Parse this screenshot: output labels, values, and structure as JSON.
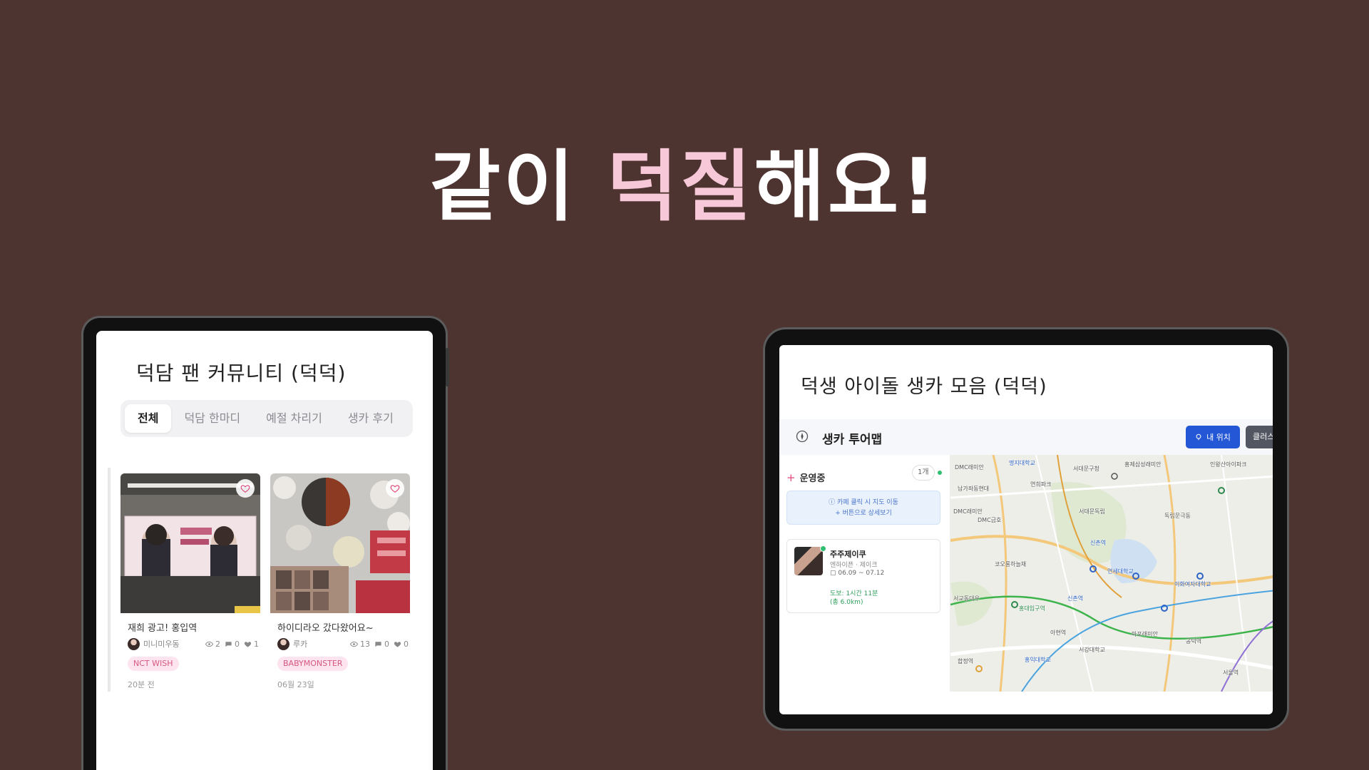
{
  "headline": {
    "part1": "같이",
    "highlight": "덕질",
    "part2": "해요!"
  },
  "colors": {
    "background": "#4e3430",
    "highlight": "#f7c9d8",
    "accent_blue": "#2457d6",
    "tag_pink": "#d9577f"
  },
  "community": {
    "title": "덕담 팬 커뮤니티 (덕덕)",
    "tabs": [
      {
        "label": "전체",
        "active": true
      },
      {
        "label": "덕담 한마디",
        "active": false
      },
      {
        "label": "예절 차리기",
        "active": false
      },
      {
        "label": "생카 후기",
        "active": false
      }
    ],
    "posts": [
      {
        "title": "재희 광고! 홍입역",
        "author": "미니미우동",
        "views": "2",
        "comments": "0",
        "likes": "1",
        "tag": "NCT WISH",
        "time": "20분 전",
        "icon": "heart-icon"
      },
      {
        "title": "하이디라오 갔다왔어요~",
        "author": "루카",
        "views": "13",
        "comments": "0",
        "likes": "0",
        "tag": "BABYMONSTER",
        "time": "06월 23일",
        "icon": "heart-icon"
      }
    ]
  },
  "map_app": {
    "title": "덕생 아이돌 생카 모음 (덕덕)",
    "header_title": "생카 투어맵",
    "my_location_button": "내 위치",
    "cluster_button": "클러스",
    "section_label": "운영중",
    "count": "1개",
    "hint_line1": "ⓘ 카페 클릭 시 지도 이동",
    "hint_line2": "+ 버튼으로 상세보기",
    "place": {
      "name": "주주제이쿠",
      "artist": "엔하이픈 · 제이크",
      "date": "06.09 ~ 07.12",
      "walk": "도보: 1시간 11분",
      "distance": "(총 6.0km)"
    },
    "map_labels": [
      "DMC래미안",
      "명지대학교",
      "서대문구청",
      "홍제삼성래미안",
      "인왕산아이파크",
      "남가좌동현대",
      "연희파크",
      "DMC금호",
      "서대문독립",
      "독립문극동",
      "DMC래미안",
      "코오롱하늘채",
      "신촌역",
      "연세대학교",
      "이화여자대학교",
      "서교동대우",
      "홍대입구역",
      "신촌역",
      "마포래미안",
      "서울역",
      "합정역",
      "홍익대학교",
      "서강대학교",
      "아현역",
      "공덕역"
    ]
  }
}
